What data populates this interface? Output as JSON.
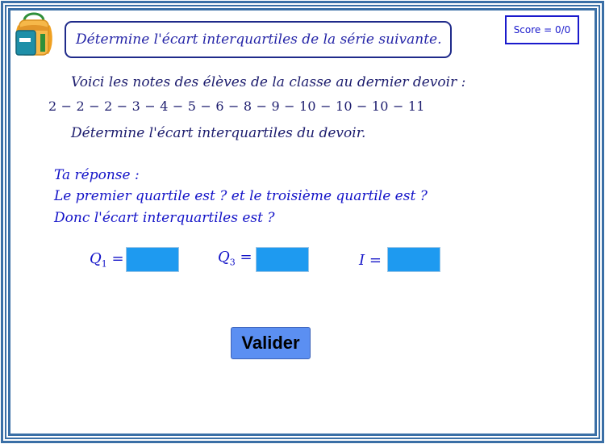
{
  "header": {
    "instruction": "Détermine l'écart interquartiles de la série suivante.",
    "score_label": "Score = 0/0"
  },
  "problem": {
    "intro": "Voici les notes des élèves de la classe au dernier devoir  :",
    "series": "2 − 2 − 2 − 3 − 4 − 5 − 6 − 8 − 9 − 10 − 10 − 10 − 11",
    "question": "Détermine l'écart interquartiles du devoir."
  },
  "answer": {
    "heading": "Ta réponse :",
    "line1": "Le premier quartile est ? et le troisième quartile est ?",
    "line2": "Donc l'écart interquartiles est ?"
  },
  "fields": {
    "q1": {
      "var": "Q",
      "sub": "1",
      "eq": " =",
      "value": ""
    },
    "q3": {
      "var": "Q",
      "sub": "3",
      "eq": " =",
      "value": ""
    },
    "i": {
      "var": "I",
      "eq": " =",
      "value": ""
    }
  },
  "buttons": {
    "validate_label": "Valider"
  },
  "icons": {
    "backpack": "backpack-icon"
  },
  "colors": {
    "frame": "#3a6fa6",
    "input_fill": "#1e9af0",
    "button_fill": "#5b8ff2",
    "text_blue": "#1414c8"
  }
}
